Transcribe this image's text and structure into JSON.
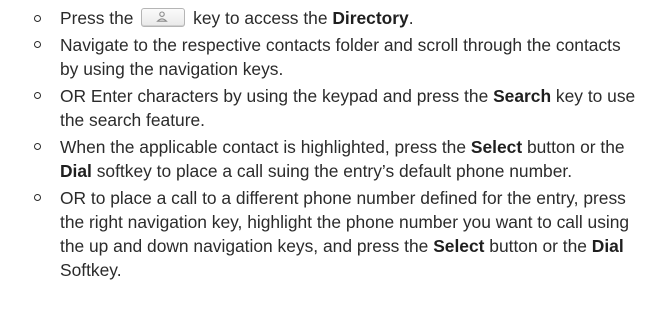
{
  "icons": {
    "directory_key": "person-icon"
  },
  "steps": [
    {
      "parts": [
        "Press the ",
        " key to access the ",
        "Directory",
        "."
      ]
    },
    {
      "text": "Navigate to the respective contacts folder  and scroll through the contacts by using the navigation keys."
    },
    {
      "parts": [
        "OR  Enter characters by using the keypad and press the ",
        "Search",
        " key to use the search feature."
      ]
    },
    {
      "parts": [
        "When the applicable contact is highlighted, press the ",
        "Select",
        " button or the ",
        "Dial",
        " softkey to place a call suing the entry’s default phone number."
      ]
    },
    {
      "parts": [
        "OR to place a call to a different phone number defined for the entry, press the right navigation key, highlight the phone number you want to call using the up and down navigation keys, and press the ",
        "Select",
        " button or the ",
        "Dial",
        " Softkey."
      ]
    }
  ]
}
